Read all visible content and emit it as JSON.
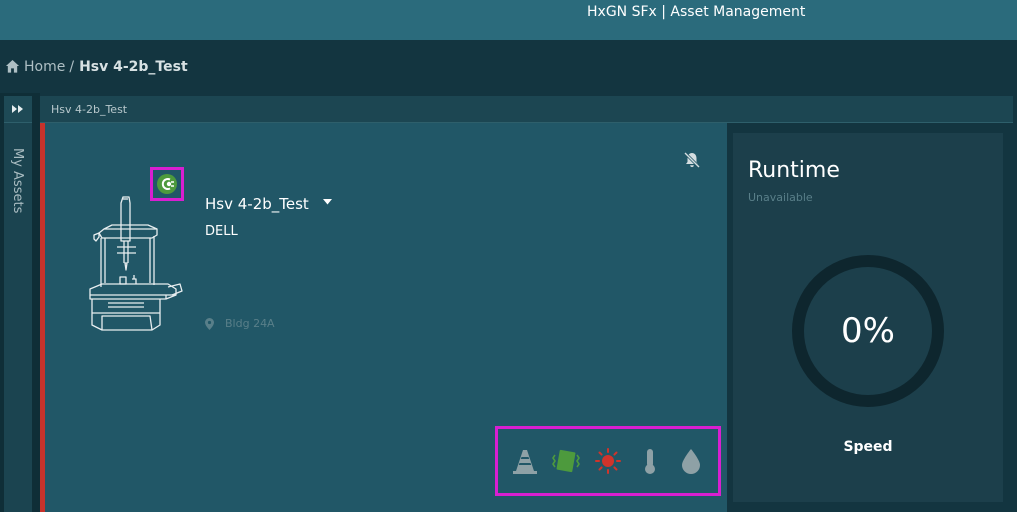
{
  "app": {
    "title": "HxGN SFx | Asset Management"
  },
  "breadcrumb": {
    "home_label": "Home",
    "separator": "/",
    "current": "Hsv 4-2b_Test"
  },
  "sidebar": {
    "label": "My Assets"
  },
  "panel": {
    "header_title": "Hsv 4-2b_Test"
  },
  "asset": {
    "name": "Hsv 4-2b_Test",
    "manufacturer": "DELL",
    "location": "Bldg 24A",
    "connection_icon": "connected-icon",
    "notification_icon": "bell-muted-icon",
    "status_color": "#c6322b"
  },
  "sensors": [
    {
      "name": "cone-icon",
      "color": "#8ea1a6"
    },
    {
      "name": "vibration-icon",
      "color": "#4d9a3d"
    },
    {
      "name": "light-sun-icon",
      "color": "#d0342b"
    },
    {
      "name": "temperature-icon",
      "color": "#8ea1a6"
    },
    {
      "name": "humidity-drop-icon",
      "color": "#8ea1a6"
    }
  ],
  "runtime": {
    "title": "Runtime",
    "subtitle": "Unavailable",
    "percent_label": "0%",
    "percent_value": 0,
    "metric_label": "Speed"
  },
  "colors": {
    "topbar": "#2b6b7c",
    "card": "#215767",
    "highlight": "#d81fd1"
  }
}
